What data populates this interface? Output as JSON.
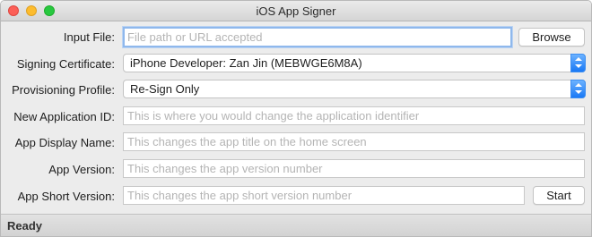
{
  "window": {
    "title": "iOS App Signer"
  },
  "form": {
    "input_file": {
      "label": "Input File:",
      "placeholder": "File path or URL accepted",
      "button": "Browse"
    },
    "signing_certificate": {
      "label": "Signing Certificate:",
      "value": "iPhone Developer: Zan Jin (MEBWGE6M8A)"
    },
    "provisioning_profile": {
      "label": "Provisioning Profile:",
      "value": "Re-Sign Only"
    },
    "new_application_id": {
      "label": "New Application ID:",
      "placeholder": "This is where you would change the application identifier"
    },
    "app_display_name": {
      "label": "App Display Name:",
      "placeholder": "This changes the app title on the home screen"
    },
    "app_version": {
      "label": "App Version:",
      "placeholder": "This changes the app version number"
    },
    "app_short_version": {
      "label": "App Short Version:",
      "placeholder": "This changes the app short version number",
      "button": "Start"
    }
  },
  "status": {
    "text": "Ready"
  }
}
